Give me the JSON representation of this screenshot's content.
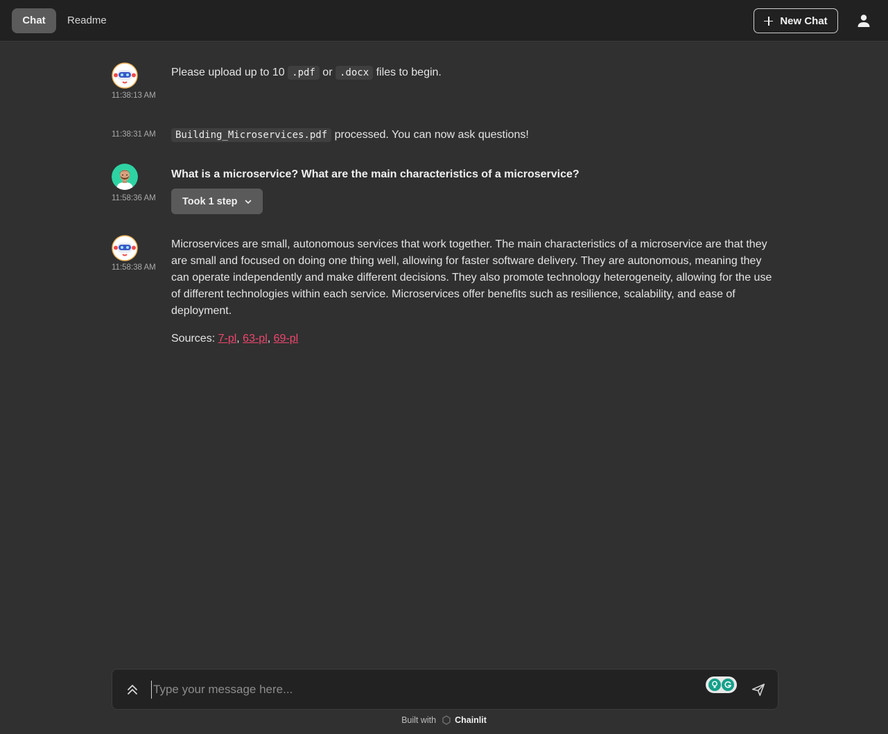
{
  "header": {
    "tabs": [
      {
        "label": "Chat",
        "active": true
      },
      {
        "label": "Readme",
        "active": false
      }
    ],
    "new_chat_label": "New Chat",
    "user_icon": "user-icon"
  },
  "messages": [
    {
      "author": "assistant",
      "avatar": "robot-avatar",
      "time": "11:38:13 AM",
      "text_before": "Please upload up to 10 ",
      "code1": ".pdf",
      "text_mid": " or ",
      "code2": ".docx",
      "text_after": " files to begin."
    },
    {
      "author": "assistant",
      "time": "11:38:31 AM",
      "code": "Building_Microservices.pdf",
      "text_after": " processed. You can now ask questions!"
    },
    {
      "author": "user",
      "avatar": "user-avatar",
      "time": "11:58:36 AM",
      "text": "What is a microservice? What are the main characteristics of a microservice?",
      "step_label": "Took 1 step"
    },
    {
      "author": "assistant",
      "avatar": "robot-avatar",
      "time": "11:58:38 AM",
      "text": "Microservices are small, autonomous services that work together. The main characteristics of a microservice are that they are small and focused on doing one thing well, allowing for faster software delivery. They are autonomous, meaning they can operate independently and make different decisions. They also promote technology heterogeneity, allowing for the use of different technologies within each service. Microservices offer benefits such as resilience, scalability, and ease of deployment.",
      "sources_label": "Sources: ",
      "sources": [
        "7-pl",
        "63-pl",
        "69-pl"
      ],
      "sources_sep": ", "
    }
  ],
  "composer": {
    "placeholder": "Type your message here..."
  },
  "footer": {
    "built_with": "Built with",
    "brand": "Chainlit"
  },
  "colors": {
    "background": "#303030",
    "header": "#212121",
    "link": "#f0466e"
  }
}
